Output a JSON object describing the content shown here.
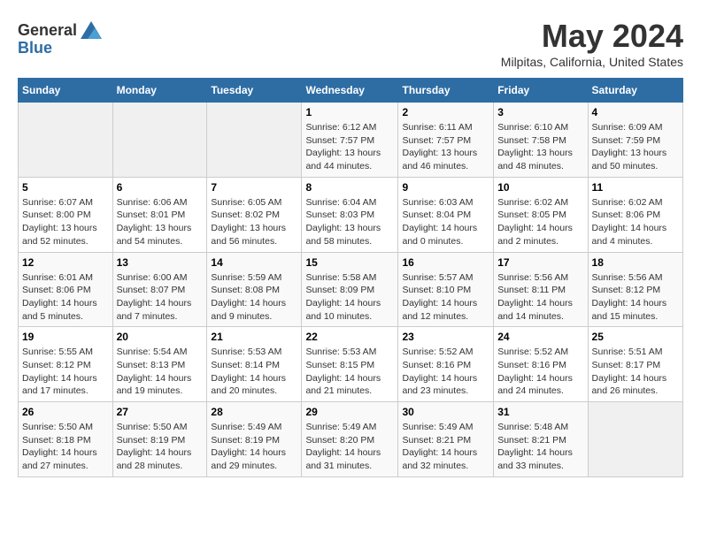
{
  "header": {
    "logo_general": "General",
    "logo_blue": "Blue",
    "month_year": "May 2024",
    "location": "Milpitas, California, United States"
  },
  "weekdays": [
    "Sunday",
    "Monday",
    "Tuesday",
    "Wednesday",
    "Thursday",
    "Friday",
    "Saturday"
  ],
  "weeks": [
    [
      {
        "day": "",
        "empty": true
      },
      {
        "day": "",
        "empty": true
      },
      {
        "day": "",
        "empty": true
      },
      {
        "day": "1",
        "sunrise": "6:12 AM",
        "sunset": "7:57 PM",
        "daylight": "13 hours and 44 minutes."
      },
      {
        "day": "2",
        "sunrise": "6:11 AM",
        "sunset": "7:57 PM",
        "daylight": "13 hours and 46 minutes."
      },
      {
        "day": "3",
        "sunrise": "6:10 AM",
        "sunset": "7:58 PM",
        "daylight": "13 hours and 48 minutes."
      },
      {
        "day": "4",
        "sunrise": "6:09 AM",
        "sunset": "7:59 PM",
        "daylight": "13 hours and 50 minutes."
      }
    ],
    [
      {
        "day": "5",
        "sunrise": "6:07 AM",
        "sunset": "8:00 PM",
        "daylight": "13 hours and 52 minutes."
      },
      {
        "day": "6",
        "sunrise": "6:06 AM",
        "sunset": "8:01 PM",
        "daylight": "13 hours and 54 minutes."
      },
      {
        "day": "7",
        "sunrise": "6:05 AM",
        "sunset": "8:02 PM",
        "daylight": "13 hours and 56 minutes."
      },
      {
        "day": "8",
        "sunrise": "6:04 AM",
        "sunset": "8:03 PM",
        "daylight": "13 hours and 58 minutes."
      },
      {
        "day": "9",
        "sunrise": "6:03 AM",
        "sunset": "8:04 PM",
        "daylight": "14 hours and 0 minutes."
      },
      {
        "day": "10",
        "sunrise": "6:02 AM",
        "sunset": "8:05 PM",
        "daylight": "14 hours and 2 minutes."
      },
      {
        "day": "11",
        "sunrise": "6:02 AM",
        "sunset": "8:06 PM",
        "daylight": "14 hours and 4 minutes."
      }
    ],
    [
      {
        "day": "12",
        "sunrise": "6:01 AM",
        "sunset": "8:06 PM",
        "daylight": "14 hours and 5 minutes."
      },
      {
        "day": "13",
        "sunrise": "6:00 AM",
        "sunset": "8:07 PM",
        "daylight": "14 hours and 7 minutes."
      },
      {
        "day": "14",
        "sunrise": "5:59 AM",
        "sunset": "8:08 PM",
        "daylight": "14 hours and 9 minutes."
      },
      {
        "day": "15",
        "sunrise": "5:58 AM",
        "sunset": "8:09 PM",
        "daylight": "14 hours and 10 minutes."
      },
      {
        "day": "16",
        "sunrise": "5:57 AM",
        "sunset": "8:10 PM",
        "daylight": "14 hours and 12 minutes."
      },
      {
        "day": "17",
        "sunrise": "5:56 AM",
        "sunset": "8:11 PM",
        "daylight": "14 hours and 14 minutes."
      },
      {
        "day": "18",
        "sunrise": "5:56 AM",
        "sunset": "8:12 PM",
        "daylight": "14 hours and 15 minutes."
      }
    ],
    [
      {
        "day": "19",
        "sunrise": "5:55 AM",
        "sunset": "8:12 PM",
        "daylight": "14 hours and 17 minutes."
      },
      {
        "day": "20",
        "sunrise": "5:54 AM",
        "sunset": "8:13 PM",
        "daylight": "14 hours and 19 minutes."
      },
      {
        "day": "21",
        "sunrise": "5:53 AM",
        "sunset": "8:14 PM",
        "daylight": "14 hours and 20 minutes."
      },
      {
        "day": "22",
        "sunrise": "5:53 AM",
        "sunset": "8:15 PM",
        "daylight": "14 hours and 21 minutes."
      },
      {
        "day": "23",
        "sunrise": "5:52 AM",
        "sunset": "8:16 PM",
        "daylight": "14 hours and 23 minutes."
      },
      {
        "day": "24",
        "sunrise": "5:52 AM",
        "sunset": "8:16 PM",
        "daylight": "14 hours and 24 minutes."
      },
      {
        "day": "25",
        "sunrise": "5:51 AM",
        "sunset": "8:17 PM",
        "daylight": "14 hours and 26 minutes."
      }
    ],
    [
      {
        "day": "26",
        "sunrise": "5:50 AM",
        "sunset": "8:18 PM",
        "daylight": "14 hours and 27 minutes."
      },
      {
        "day": "27",
        "sunrise": "5:50 AM",
        "sunset": "8:19 PM",
        "daylight": "14 hours and 28 minutes."
      },
      {
        "day": "28",
        "sunrise": "5:49 AM",
        "sunset": "8:19 PM",
        "daylight": "14 hours and 29 minutes."
      },
      {
        "day": "29",
        "sunrise": "5:49 AM",
        "sunset": "8:20 PM",
        "daylight": "14 hours and 31 minutes."
      },
      {
        "day": "30",
        "sunrise": "5:49 AM",
        "sunset": "8:21 PM",
        "daylight": "14 hours and 32 minutes."
      },
      {
        "day": "31",
        "sunrise": "5:48 AM",
        "sunset": "8:21 PM",
        "daylight": "14 hours and 33 minutes."
      },
      {
        "day": "",
        "empty": true
      }
    ]
  ],
  "labels": {
    "sunrise_prefix": "Sunrise: ",
    "sunset_prefix": "Sunset: ",
    "daylight_prefix": "Daylight: "
  }
}
